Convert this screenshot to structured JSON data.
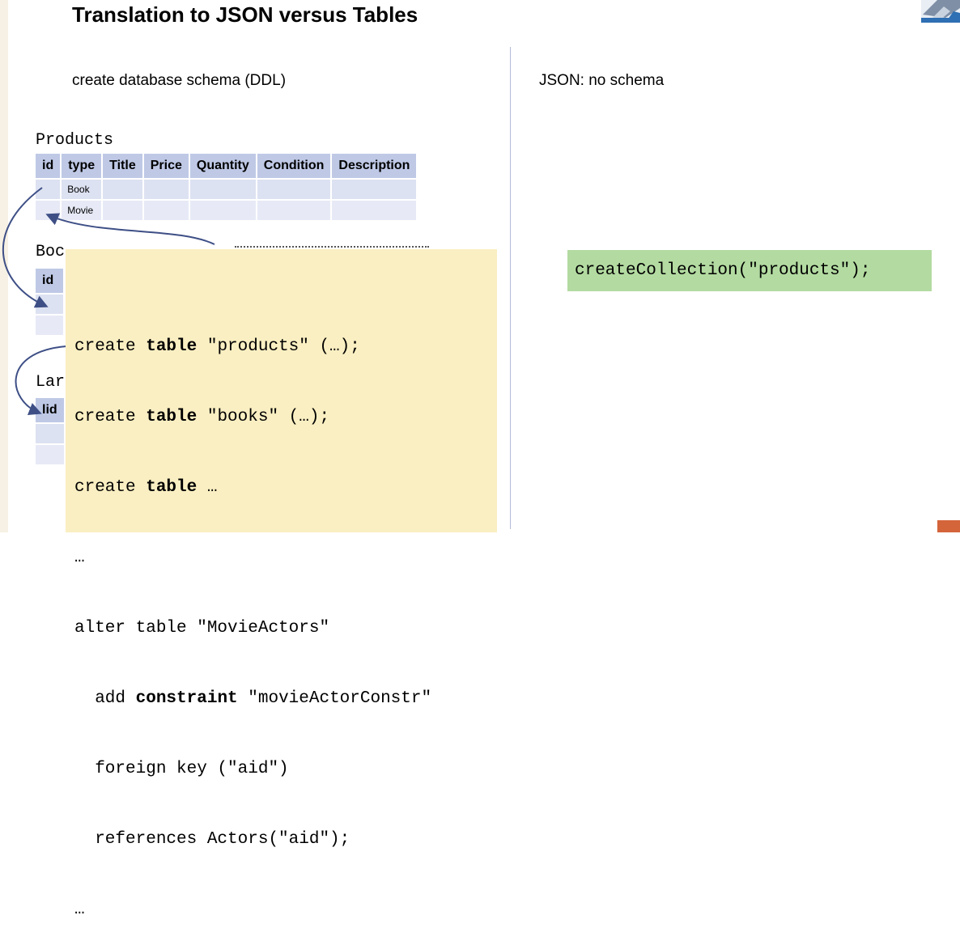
{
  "slide": {
    "title": "Translation to JSON versus Tables",
    "left_heading": "create database schema (DDL)",
    "right_heading": "JSON: no schema"
  },
  "products_table": {
    "name": "Products",
    "headers": [
      "id",
      "type",
      "Title",
      "Price",
      "Quantity",
      "Condition",
      "Description"
    ],
    "rows": [
      [
        "",
        "Book",
        "",
        "",
        "",
        "",
        ""
      ],
      [
        "",
        "Movie",
        "",
        "",
        "",
        "",
        ""
      ]
    ]
  },
  "partial_tables": {
    "books_name": "Boc",
    "books_header": "id",
    "lang_name": "Lar",
    "lang_header": "lid"
  },
  "ddl_code": {
    "lines": [
      {
        "before": "create ",
        "kw": "table",
        "after": " \"products\" (…);"
      },
      {
        "before": "create ",
        "kw": "table",
        "after": " \"books\" (…);"
      },
      {
        "before": "create ",
        "kw": "table",
        "after": " …"
      },
      {
        "before": "…",
        "kw": "",
        "after": ""
      },
      {
        "before": "alter table \"MovieActors\"",
        "kw": "",
        "after": ""
      },
      {
        "before": "  add ",
        "kw": "constraint",
        "after": " \"movieActorConstr\""
      },
      {
        "before": "  foreign key (\"aid\")",
        "kw": "",
        "after": ""
      },
      {
        "before": "  references Actors(\"aid\");",
        "kw": "",
        "after": ""
      },
      {
        "before": "…",
        "kw": "",
        "after": ""
      }
    ]
  },
  "json_code": {
    "text": "createCollection(\"products\");"
  },
  "colors": {
    "header_cell": "#bfc9e6",
    "body_cell": "#dde2f2",
    "code_background": "#faefc2",
    "json_background": "#b3dba1",
    "arrow": "#3e4f86"
  }
}
